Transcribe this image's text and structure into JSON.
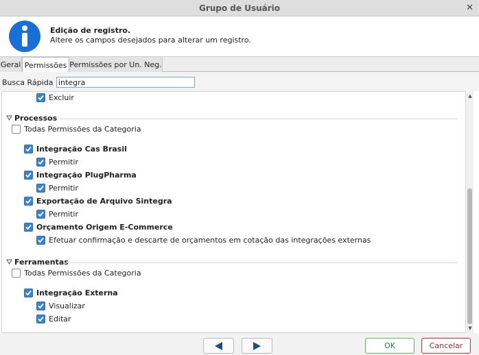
{
  "window": {
    "title": "Grupo de Usuário"
  },
  "header": {
    "title": "Edição de registro.",
    "subtitle": "Altere os campos desejados para alterar um registro."
  },
  "tabs": [
    {
      "label": "Geral",
      "active": false
    },
    {
      "label": "Permissões",
      "active": true
    },
    {
      "label": "Permissões por Un. Neg.",
      "active": false
    }
  ],
  "search": {
    "label": "Busca Rápida",
    "value": "integra"
  },
  "tree": {
    "top_partial": {
      "label": "Excluir",
      "checked": true
    },
    "categories": [
      {
        "name": "Processos",
        "all_label": "Todas Permissões da Categoria",
        "all_checked": false,
        "items": [
          {
            "label": "Integração Cas Brasil",
            "checked": true,
            "children": [
              {
                "label": "Permitir",
                "checked": true
              }
            ]
          },
          {
            "label": "Integração PlugPharma",
            "checked": true,
            "children": [
              {
                "label": "Permitir",
                "checked": true
              }
            ]
          },
          {
            "label": "Exportação de Arquivo Sintegra",
            "checked": true,
            "children": [
              {
                "label": "Permitir",
                "checked": true
              }
            ]
          },
          {
            "label": "Orçamento Origem E-Commerce",
            "checked": true,
            "children": [
              {
                "label": "Efetuar confirmação e descarte de orçamentos em cotação das integrações externas",
                "checked": true
              }
            ]
          }
        ]
      },
      {
        "name": "Ferramentas",
        "all_label": "Todas Permissões da Categoria",
        "all_checked": false,
        "items": [
          {
            "label": "Integração Externa",
            "checked": true,
            "children": [
              {
                "label": "Visualizar",
                "checked": true
              },
              {
                "label": "Editar",
                "checked": true
              }
            ]
          }
        ]
      }
    ]
  },
  "footer": {
    "ok_label": "OK",
    "cancel_label": "Cancelar"
  },
  "colors": {
    "accent": "#3c82d2",
    "ok": "#5cb85c",
    "cancel": "#c9302c"
  }
}
